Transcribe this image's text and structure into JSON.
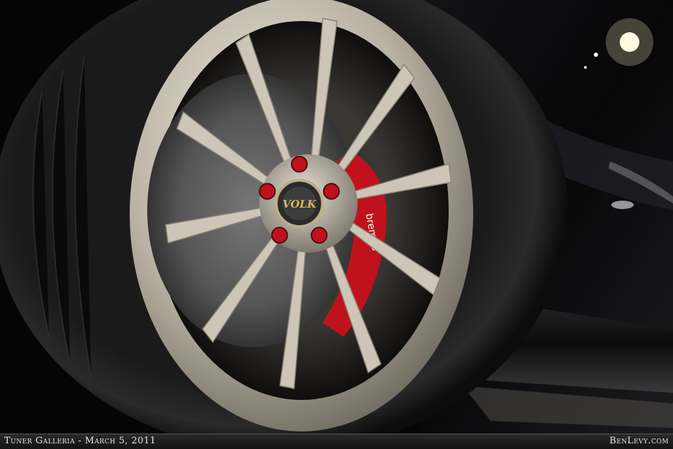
{
  "photo": {
    "subject": "wheel-photo",
    "wheel_badge_text": "VOLK",
    "caliper_logo_text": "brembo"
  },
  "caption": {
    "left": "Tuner Galleria - March 5, 2011",
    "right": "BenLevy.com"
  },
  "colors": {
    "caliper": "#c0121c",
    "rim": "#c8c2b6",
    "body": "#0a0a0c"
  }
}
